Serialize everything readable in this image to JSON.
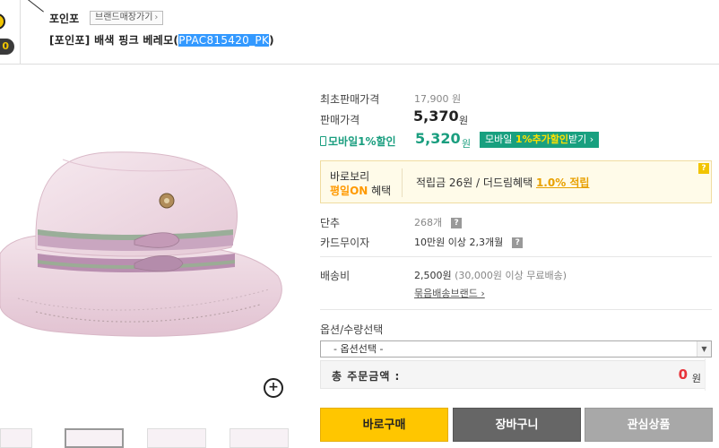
{
  "header": {
    "coin_text": "",
    "badge_text": "0",
    "brand": "포인포",
    "brand_store_label": "브랜드매장가기",
    "title_prefix": "[포인포] 배색 핑크 베레모(",
    "product_code": "PPAC815420_PK",
    "title_suffix": ")"
  },
  "price": {
    "original_label": "최초판매가격",
    "original_value": "17,900 원",
    "sale_label": "판매가격",
    "sale_value": "5,370",
    "sale_unit": "원",
    "mobile_label": "모바일1%할인",
    "mobile_value": "5,320",
    "mobile_unit": "원",
    "mobile_btn_pre": "모바일 ",
    "mobile_btn_hi": "1%추가할인",
    "mobile_btn_post": "받기 ›"
  },
  "benefit": {
    "title_line1": "바로보리",
    "title_on": "평일ON",
    "title_line2_suffix": " 혜택",
    "text": "적립금 26원 / 더드림혜택 ",
    "link": "1.0% 적립",
    "help": "?"
  },
  "details": {
    "rows": [
      {
        "label": "단추",
        "value": "268개"
      },
      {
        "label": "카드무이자",
        "value": "10만원 이상 2,3개월"
      }
    ],
    "shipping_label": "배송비",
    "shipping_value": "2,500원",
    "shipping_note": "(30,000원 이상 무료배송)",
    "bundle_link": "묶음배송브랜드 ›",
    "help": "?"
  },
  "options": {
    "label": "옵션/수량선택",
    "select_value": "- 옵션선택 -",
    "total_label": "총 주문금액 :",
    "total_value": "0",
    "total_unit": "원"
  },
  "buttons": {
    "buy": "바로구매",
    "cart": "장바구니",
    "wish": "관심상품"
  },
  "icons": {
    "zoom": "zoom-plus-icon"
  },
  "colors": {
    "accent_green": "#1a9e7f",
    "buy_yellow": "#ffc600",
    "total_red": "#e8333a",
    "benefit_orange": "#e8a000"
  }
}
